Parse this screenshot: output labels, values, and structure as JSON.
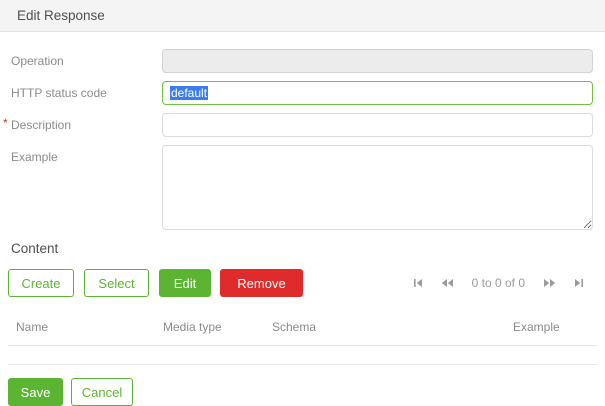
{
  "dialog": {
    "title": "Edit Response"
  },
  "form": {
    "operation_label": "Operation",
    "operation_value": "",
    "http_status_label": "HTTP status code",
    "http_status_value": "default",
    "description_label": "Description",
    "description_required_marker": "*",
    "description_value": "",
    "example_label": "Example",
    "example_value": ""
  },
  "content": {
    "heading": "Content",
    "buttons": {
      "create": "Create",
      "select": "Select",
      "edit": "Edit",
      "remove": "Remove"
    },
    "pager": {
      "count_text": "0 to 0 of 0",
      "icons": [
        "first-page-icon",
        "fast-backward-icon",
        "fast-forward-icon",
        "last-page-icon"
      ]
    },
    "table": {
      "headers": [
        "Name",
        "Media type",
        "Schema",
        "Example"
      ]
    }
  },
  "footer": {
    "save": "Save",
    "cancel": "Cancel"
  },
  "colors": {
    "accent_green": "#5cb532",
    "danger_red": "#df2b2b",
    "selection_blue": "#3b7ded",
    "header_bg": "#f4f4f4",
    "label_gray": "#8b8b8b"
  }
}
